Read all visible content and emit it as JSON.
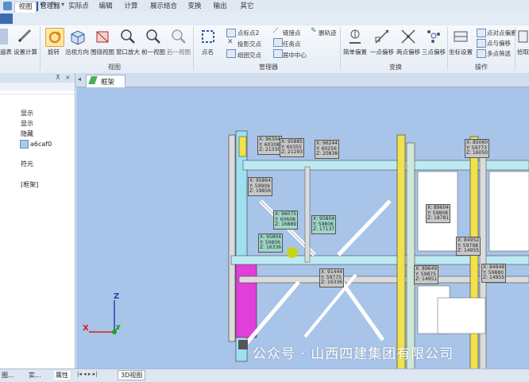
{
  "menu": {
    "tabs": [
      "视图",
      "管理器",
      "实际点",
      "编辑",
      "计算",
      "展示结合",
      "变换",
      "输出",
      "其它"
    ],
    "active_index": 0
  },
  "ribbon": {
    "buttons": {
      "rotate": "旋转",
      "view_dir": "沿视方向",
      "rotate_center": "围绕视图",
      "zoom_window": "窗口放大",
      "prev_view": "前一视图",
      "next_view": "后一视图",
      "point_name": "点名",
      "point_name2": "点标点2",
      "mirror": "投影交点",
      "link": "链接点",
      "single_label": "组团交点",
      "delete_trace": "删轨迹",
      "task_point": "任务点",
      "center": "居中中心",
      "simple": "简单偏置",
      "one_point": "一点偏移",
      "two_point": "两点偏移",
      "three_point": "三点偏移",
      "coord_set": "坐标设置",
      "point_to_point": "点对点偏置",
      "points_note": "点与偏移",
      "multi_pick": "多点筛选",
      "pick": "拾取"
    },
    "group_labels": {
      "view": "视图",
      "manager": "管理器",
      "transform": "变换",
      "operate": "操作"
    }
  },
  "left_panel": {
    "rows": [
      {
        "label": "显示"
      },
      {
        "label": "显示"
      },
      {
        "label": "隐藏"
      },
      {
        "label": "a6caf0",
        "color": "#a6caf0"
      },
      {
        "label": "符元"
      },
      {
        "label": "[框架]"
      }
    ],
    "bottom_tabs": [
      "图...",
      "实...",
      "属性"
    ]
  },
  "doc_tab": {
    "label": "框架"
  },
  "bottom_tab": {
    "label": "3D视图"
  },
  "axes": {
    "x": "X",
    "y": "Y",
    "z": "Z"
  },
  "labels": [
    "X: 96304\nY: 60308\nZ: 21330",
    "X: 95885\nY: 60355\nZ: 21293",
    "X: 96244\nY: 60256\nZ: 20838",
    "X: 95864\nY: 59909\nZ: 19856",
    "X: 96075\nY: 60608\nZ: 16889",
    "X: 95804\nY: 59806\nZ: 17137",
    "X: 95804\nY: 59806\nZ: 16336",
    "X: 91444\nY: 59775\nZ: 16336",
    "X: 89649\nY: 59875\nZ: 14951",
    "X: 89604\nY: 59808\nZ: 18781",
    "X: 85060\nY: 59773\nZ: 16050",
    "X: 84952\nY: 59798\nZ: 14955",
    "X: 84948\nY: 59880\nZ: 14955"
  ],
  "watermark": "公众号 · 山西四建集团有限公司",
  "colors": {
    "viewport_bg": "#a8c4e8",
    "label_bg": "#c8c8c8",
    "label_highlight": "#9fd6c9",
    "beam_yellow": "#f2e14b",
    "column_magenta": "#e040d8"
  }
}
